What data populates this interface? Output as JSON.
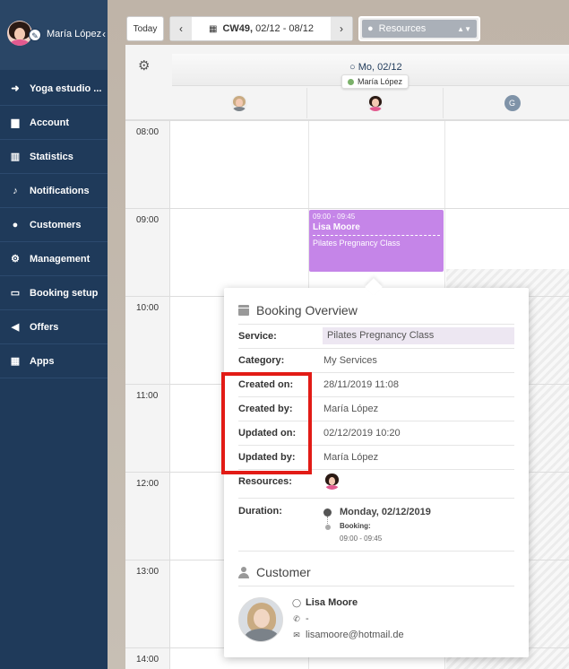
{
  "user": {
    "name": "María López"
  },
  "nav": {
    "items": [
      {
        "icon": "arrow-circle-icon",
        "glyph": "➜",
        "label": "Yoga estudio ..."
      },
      {
        "icon": "briefcase-icon",
        "glyph": "▆",
        "label": "Account"
      },
      {
        "icon": "bar-chart-icon",
        "glyph": "▥",
        "label": "Statistics"
      },
      {
        "icon": "bell-icon",
        "glyph": "♪",
        "label": "Notifications"
      },
      {
        "icon": "user-icon",
        "glyph": "●",
        "label": "Customers"
      },
      {
        "icon": "gears-icon",
        "glyph": "⚙",
        "label": "Management"
      },
      {
        "icon": "laptop-icon",
        "glyph": "▭",
        "label": "Booking setup"
      },
      {
        "icon": "megaphone-icon",
        "glyph": "◀",
        "label": "Offers"
      },
      {
        "icon": "grid-icon",
        "glyph": "▦",
        "label": "Apps"
      }
    ]
  },
  "toolbar": {
    "today_label": "Today",
    "week_bold": "CW49,",
    "week_range": "02/12 - 08/12",
    "resources_label": "Resources"
  },
  "calendar": {
    "day_label": "Mo, 02/12",
    "tooltip_name": "María López",
    "resource_initial": "G",
    "hours": [
      "08:00",
      "09:00",
      "10:00",
      "11:00",
      "12:00",
      "13:00",
      "14:00"
    ]
  },
  "event": {
    "time": "09:00 - 09:45",
    "name": "Lisa Moore",
    "service": "Pilates Pregnancy Class",
    "color": "#c585e8"
  },
  "booking": {
    "title": "Booking Overview",
    "rows": [
      {
        "label": "Service:",
        "value": "Pilates Pregnancy Class"
      },
      {
        "label": "Category:",
        "value": "My Services"
      },
      {
        "label": "Created on:",
        "value": "28/11/2019 11:08"
      },
      {
        "label": "Created by:",
        "value": "María López"
      },
      {
        "label": "Updated on:",
        "value": "02/12/2019 10:20"
      },
      {
        "label": "Updated by:",
        "value": "María López"
      },
      {
        "label": "Resources:",
        "value": ""
      }
    ],
    "duration_label": "Duration:",
    "duration_date": "Monday, 02/12/2019",
    "duration_booking": "Booking:",
    "duration_time": "09:00 - 09:45"
  },
  "customer": {
    "title": "Customer",
    "name": "Lisa Moore",
    "phone": "-",
    "email": "lisamoore@hotmail.de"
  },
  "colors": {
    "sidebar": "#1f3a5a",
    "highlight": "#e21b16"
  }
}
